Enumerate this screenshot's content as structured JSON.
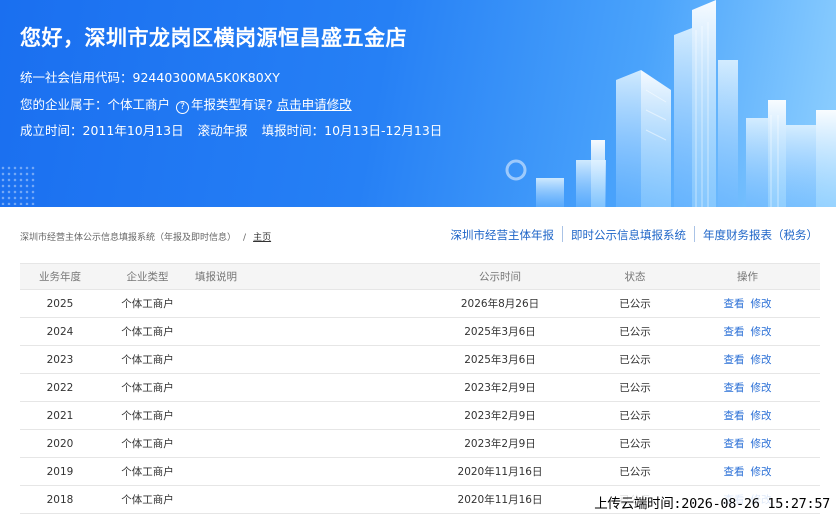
{
  "banner": {
    "title": "您好，深圳市龙岗区横岗源恒昌盛五金店",
    "credit_code_label": "统一社会信用代码：",
    "credit_code": "92440300MA5K0K80XY",
    "type_label": "您的企业属于：",
    "type_value": "个体工商户",
    "type_question": "年报类型有误?",
    "type_link": "点击申请修改",
    "est_label": "成立时间：",
    "est_value": "2011年10月13日",
    "rolling": "滚动年报",
    "fill_label": "填报时间：",
    "fill_value": "10月13日-12月13日",
    "question_icon_glyph": "?"
  },
  "nav": {
    "breadcrumb_system": "深圳市经营主体公示信息填报系统（年报及即时信息）",
    "breadcrumb_sep": "/",
    "breadcrumb_home": "主页",
    "links": [
      "深圳市经营主体年报",
      "即时公示信息填报系统",
      "年度财务报表（税务）"
    ]
  },
  "table": {
    "headers": [
      "业务年度",
      "企业类型",
      "填报说明",
      "公示时间",
      "状态",
      "操作"
    ],
    "rows": [
      {
        "year": "2025",
        "type": "个体工商户",
        "note": "",
        "time": "2026年8月26日",
        "status": "已公示",
        "view": "查看",
        "edit": "修改"
      },
      {
        "year": "2024",
        "type": "个体工商户",
        "note": "",
        "time": "2025年3月6日",
        "status": "已公示",
        "view": "查看",
        "edit": "修改"
      },
      {
        "year": "2023",
        "type": "个体工商户",
        "note": "",
        "time": "2025年3月6日",
        "status": "已公示",
        "view": "查看",
        "edit": "修改"
      },
      {
        "year": "2022",
        "type": "个体工商户",
        "note": "",
        "time": "2023年2月9日",
        "status": "已公示",
        "view": "查看",
        "edit": "修改"
      },
      {
        "year": "2021",
        "type": "个体工商户",
        "note": "",
        "time": "2023年2月9日",
        "status": "已公示",
        "view": "查看",
        "edit": "修改"
      },
      {
        "year": "2020",
        "type": "个体工商户",
        "note": "",
        "time": "2023年2月9日",
        "status": "已公示",
        "view": "查看",
        "edit": "修改"
      },
      {
        "year": "2019",
        "type": "个体工商户",
        "note": "",
        "time": "2020年11月16日",
        "status": "已公示",
        "view": "查看",
        "edit": "修改"
      },
      {
        "year": "2018",
        "type": "个体工商户",
        "note": "",
        "time": "2020年11月16日",
        "status": "已公示",
        "view": "查看",
        "edit": "修改"
      }
    ]
  },
  "watermark": "上传云端时间:2026-08-26 15:27:57",
  "colors": {
    "banner_start": "#1a6ff0",
    "banner_end": "#8fd0ff",
    "link": "#1f66c8",
    "header_bg": "#f5f5f5"
  }
}
